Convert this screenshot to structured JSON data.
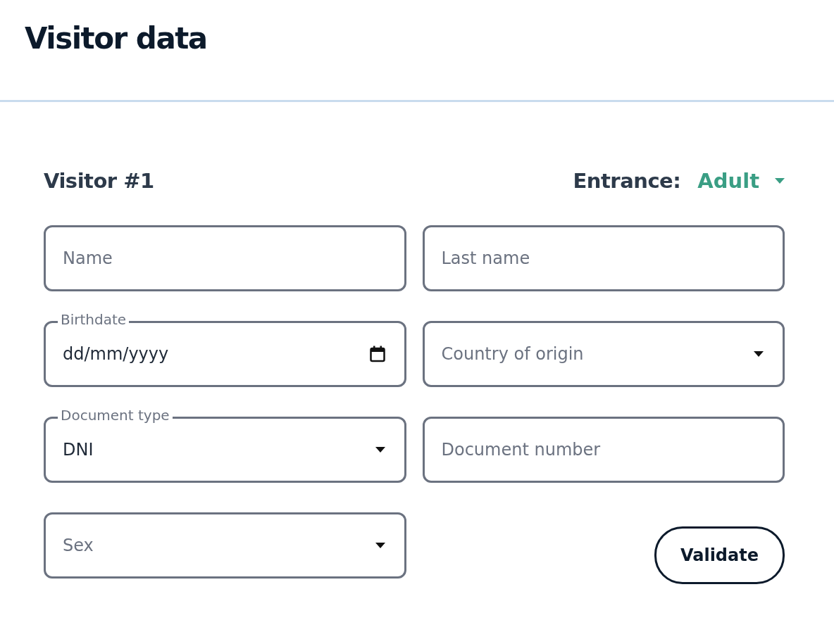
{
  "header": {
    "title": "Visitor data"
  },
  "visitor": {
    "title": "Visitor #1",
    "entrance_label": "Entrance:",
    "entrance_value": "Adult"
  },
  "fields": [
    {
      "kind": "text",
      "placeholder": "Name"
    },
    {
      "kind": "text",
      "placeholder": "Last name"
    },
    {
      "kind": "date",
      "label": "Birthdate",
      "value": "dd/mm/yyyy"
    },
    {
      "kind": "select",
      "placeholder": "Country of origin"
    },
    {
      "kind": "select",
      "label": "Document type",
      "value": "DNI"
    },
    {
      "kind": "text",
      "placeholder": "Document number"
    },
    {
      "kind": "select",
      "placeholder": "Sex"
    }
  ],
  "buttons": [
    {
      "label": "Validate"
    }
  ]
}
